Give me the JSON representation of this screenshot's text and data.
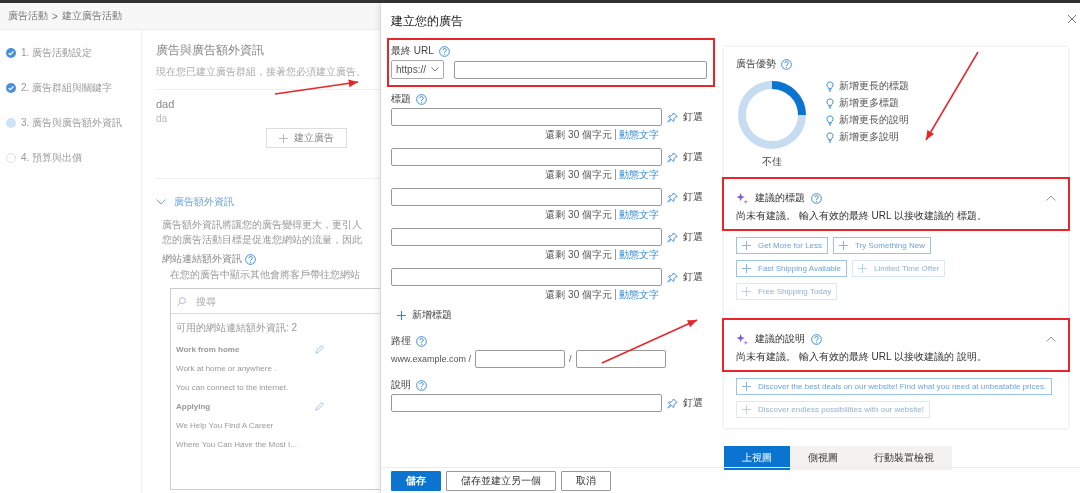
{
  "background_page": {
    "breadcrumb": [
      "廣告活動",
      "建立廣告活動"
    ],
    "breadcrumb_separator": ">",
    "steps": [
      {
        "label": "1. 廣告活動設定",
        "completed": true,
        "selected": false
      },
      {
        "label": "2. 廣告群組與關鍵字",
        "completed": true,
        "selected": false
      },
      {
        "label": "3. 廣告與廣告額外資訊",
        "completed": false,
        "selected": true
      },
      {
        "label": "4. 預算與出價",
        "completed": false,
        "selected": false
      }
    ],
    "heading": "廣告與廣告額外資訊",
    "subtitle": "現在您已建立廣告群組，接著您必須建立廣告。",
    "ad_group": {
      "name": "dad",
      "detail": "da"
    },
    "create_ad_button": "建立廣告",
    "extensions": {
      "title": "廣告額外資訊",
      "expanded": true,
      "description": [
        "廣告額外資訊將讓您的廣告變得更大，更引人",
        "您的廣告活動目標是促進您網站的流量，因此"
      ],
      "sitelinks_label": "網站連結額外資訊",
      "sitelinks_hint": "在您的廣告中顯示其他會將客戶帶往您網站",
      "search": {
        "placeholder": "搜尋"
      },
      "available_label": "可用的網站連結額外資訊: 2",
      "items": [
        {
          "title": "Work from home",
          "lines": [
            "Work at home or anywhere .",
            "You can connect to the internet."
          ]
        },
        {
          "title": "Applying",
          "lines": [
            "We Help You Find A Career",
            "Where You Can Have the Most I..."
          ]
        }
      ]
    }
  },
  "dialog": {
    "title": "建立您的廣告",
    "final_url": {
      "label": "最終 URL",
      "highlighted": true,
      "protocol": "https://"
    },
    "headlines": {
      "label": "標題",
      "items": [
        {
          "counter": "還剩 30 個字元",
          "link": "動態文字",
          "pin": "釘選"
        },
        {
          "counter": "還剩 30 個字元",
          "link": "動態文字",
          "pin": "釘選"
        },
        {
          "counter": "還剩 30 個字元",
          "link": "動態文字",
          "pin": "釘選"
        },
        {
          "counter": "還剩 30 個字元",
          "link": "動態文字",
          "pin": "釘選"
        },
        {
          "counter": "還剩 30 個字元",
          "link": "動態文字",
          "pin": "釘選"
        }
      ]
    },
    "add_headline": "新增標題",
    "path": {
      "label": "路徑",
      "domain": "www.example.com /",
      "separator": "/"
    },
    "descriptions": {
      "label": "說明",
      "items": [
        {
          "pin": "釘選"
        }
      ]
    },
    "ad_strength": {
      "title": "廣告優勢",
      "level": 0.25,
      "rating": "不佳",
      "tips": [
        "新增更長的標題",
        "新增更多標題",
        "新增更長的說明",
        "新增更多說明"
      ]
    },
    "suggested_headlines": {
      "title": "建議的標題",
      "highlighted": true,
      "expanded": true,
      "message": "尚未有建議。 輸入有效的最終 URL 以接收建議的 標題。",
      "chips": [
        {
          "label": "Get More for Less",
          "disabled": false
        },
        {
          "label": "Try Something New",
          "disabled": false
        },
        {
          "label": "Fast Shipping Available",
          "disabled": false
        },
        {
          "label": "Limited Time Offer",
          "disabled": true
        },
        {
          "label": "Free Shipping Today",
          "disabled": true
        }
      ]
    },
    "suggested_descriptions": {
      "title": "建議的說明",
      "highlighted": true,
      "expanded": true,
      "message": "尚未有建議。 輸入有效的最終 URL 以接收建議的 說明。",
      "chips": [
        {
          "label": "Discover the best deals on our website! Find what you need at unbeatable prices.",
          "disabled": false
        },
        {
          "label": "Discover endless possibilities with our website!",
          "disabled": true
        }
      ]
    },
    "preview_tabs": [
      {
        "label": "上視圖",
        "selected": true
      },
      {
        "label": "側視圖",
        "selected": false
      },
      {
        "label": "行動裝置檢視",
        "selected": false
      }
    ],
    "footer_buttons": [
      {
        "label": "儲存",
        "kind": "primary"
      },
      {
        "label": "儲存並建立另一個",
        "kind": "secondary"
      },
      {
        "label": "取消",
        "kind": "secondary"
      }
    ]
  }
}
